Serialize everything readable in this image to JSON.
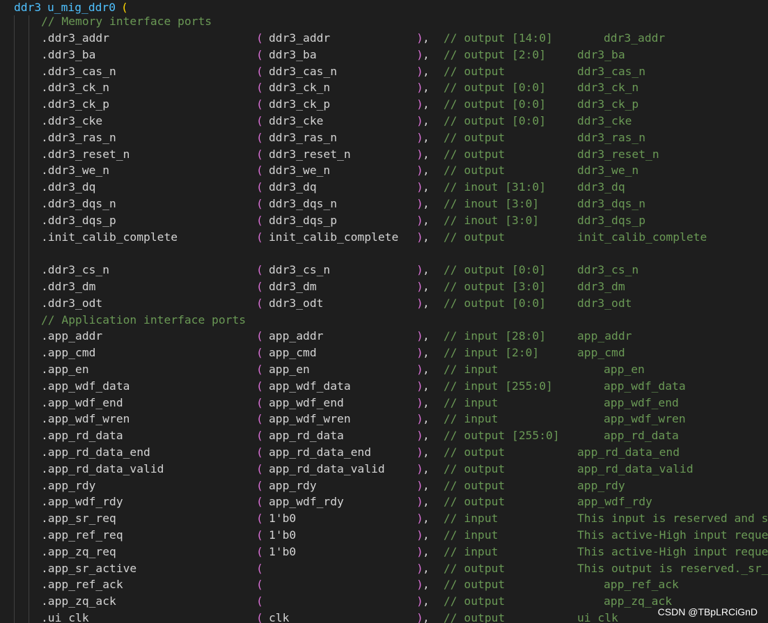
{
  "editor": {
    "instance_header": {
      "module": "ddr3",
      "instance": "u_mig_ddr0",
      "open_paren": "("
    },
    "section_memory": "// Memory interface ports",
    "section_app": "// Application interface ports",
    "ports": [
      {
        "port": ".ddr3_addr",
        "signal": "ddr3_addr",
        "dir": "// output [14:0]",
        "desc": "ddr3_addr",
        "desc_indent": true
      },
      {
        "port": ".ddr3_ba",
        "signal": "ddr3_ba",
        "dir": "// output [2:0]",
        "desc": "ddr3_ba",
        "desc_indent": false
      },
      {
        "port": ".ddr3_cas_n",
        "signal": "ddr3_cas_n",
        "dir": "// output",
        "desc": "ddr3_cas_n",
        "desc_indent": false
      },
      {
        "port": ".ddr3_ck_n",
        "signal": "ddr3_ck_n",
        "dir": "// output [0:0]",
        "desc": "ddr3_ck_n",
        "desc_indent": false
      },
      {
        "port": ".ddr3_ck_p",
        "signal": "ddr3_ck_p",
        "dir": "// output [0:0]",
        "desc": "ddr3_ck_p",
        "desc_indent": false
      },
      {
        "port": ".ddr3_cke",
        "signal": "ddr3_cke",
        "dir": "// output [0:0]",
        "desc": "ddr3_cke",
        "desc_indent": false
      },
      {
        "port": ".ddr3_ras_n",
        "signal": "ddr3_ras_n",
        "dir": "// output",
        "desc": "ddr3_ras_n",
        "desc_indent": false
      },
      {
        "port": ".ddr3_reset_n",
        "signal": "ddr3_reset_n",
        "dir": "// output",
        "desc": "ddr3_reset_n",
        "desc_indent": false
      },
      {
        "port": ".ddr3_we_n",
        "signal": "ddr3_we_n",
        "dir": "// output",
        "desc": "ddr3_we_n",
        "desc_indent": false
      },
      {
        "port": ".ddr3_dq",
        "signal": "ddr3_dq",
        "dir": "// inout [31:0]",
        "desc": "ddr3_dq",
        "desc_indent": false
      },
      {
        "port": ".ddr3_dqs_n",
        "signal": "ddr3_dqs_n",
        "dir": "// inout [3:0]",
        "desc": "ddr3_dqs_n",
        "desc_indent": false
      },
      {
        "port": ".ddr3_dqs_p",
        "signal": "ddr3_dqs_p",
        "dir": "// inout [3:0]",
        "desc": "ddr3_dqs_p",
        "desc_indent": false
      },
      {
        "port": ".init_calib_complete",
        "signal": "init_calib_complete",
        "dir": "// output",
        "desc": "init_calib_complete",
        "desc_indent": false
      },
      {
        "blank": true
      },
      {
        "port": ".ddr3_cs_n",
        "signal": "ddr3_cs_n",
        "dir": "// output [0:0]",
        "desc": "ddr3_cs_n",
        "desc_indent": false
      },
      {
        "port": ".ddr3_dm",
        "signal": "ddr3_dm",
        "dir": "// output [3:0]",
        "desc": "ddr3_dm",
        "desc_indent": false
      },
      {
        "port": ".ddr3_odt",
        "signal": "ddr3_odt",
        "dir": "// output [0:0]",
        "desc": "ddr3_odt",
        "desc_indent": false
      },
      {
        "section": "app"
      },
      {
        "port": ".app_addr",
        "signal": "app_addr",
        "dir": "// input [28:0]",
        "desc": "app_addr",
        "desc_indent": false
      },
      {
        "port": ".app_cmd",
        "signal": "app_cmd",
        "dir": "// input [2:0]",
        "desc": "app_cmd",
        "desc_indent": false
      },
      {
        "port": ".app_en",
        "signal": "app_en",
        "dir": "// input",
        "desc": "app_en",
        "desc_indent": true
      },
      {
        "port": ".app_wdf_data",
        "signal": "app_wdf_data",
        "dir": "// input [255:0]",
        "desc": "app_wdf_data",
        "desc_indent": true
      },
      {
        "port": ".app_wdf_end",
        "signal": "app_wdf_end",
        "dir": "// input",
        "desc": "app_wdf_end",
        "desc_indent": true
      },
      {
        "port": ".app_wdf_wren",
        "signal": "app_wdf_wren",
        "dir": "// input",
        "desc": "app_wdf_wren",
        "desc_indent": true
      },
      {
        "port": ".app_rd_data",
        "signal": "app_rd_data",
        "dir": "// output [255:0]",
        "desc": "app_rd_data",
        "desc_indent": true
      },
      {
        "port": ".app_rd_data_end",
        "signal": "app_rd_data_end",
        "dir": "// output",
        "desc": "app_rd_data_end",
        "desc_indent": false
      },
      {
        "port": ".app_rd_data_valid",
        "signal": "app_rd_data_valid",
        "dir": "// output",
        "desc": "app_rd_data_valid",
        "desc_indent": false
      },
      {
        "port": ".app_rdy",
        "signal": "app_rdy",
        "dir": "// output",
        "desc": "app_rdy",
        "desc_indent": false
      },
      {
        "port": ".app_wdf_rdy",
        "signal": "app_wdf_rdy",
        "dir": "// output",
        "desc": "app_wdf_rdy",
        "desc_indent": false
      },
      {
        "port": ".app_sr_req",
        "signal": "1'b0",
        "dir": "// input",
        "desc": "This input is reserved and sh",
        "desc_indent": false
      },
      {
        "port": ".app_ref_req",
        "signal": "1'b0",
        "dir": "// input",
        "desc": "This active-High input reques",
        "desc_indent": false
      },
      {
        "port": ".app_zq_req",
        "signal": "1'b0",
        "dir": "// input",
        "desc": "This active-High input reques",
        "desc_indent": false
      },
      {
        "port": ".app_sr_active",
        "signal": "",
        "dir": "// output",
        "desc": "This output is reserved._sr_a",
        "desc_indent": false
      },
      {
        "port": ".app_ref_ack",
        "signal": "",
        "dir": "// output",
        "desc": "app_ref_ack",
        "desc_indent": true
      },
      {
        "port": ".app_zq_ack",
        "signal": "",
        "dir": "// output",
        "desc": "app_zq_ack",
        "desc_indent": true
      },
      {
        "port": ".ui_clk",
        "signal": "clk",
        "dir": "// output",
        "desc": "ui_clk",
        "desc_indent": false
      }
    ],
    "paren_open": "(",
    "paren_close": ")",
    "comma": ","
  },
  "watermark": "CSDN @TBpLRCiGnD",
  "colors": {
    "background": "#1e1e1e",
    "instance": "#4fc1ff",
    "bracket_gold": "#ffd700",
    "bracket_purple": "#da70d6",
    "comment": "#6a9955",
    "text": "#d4d4d4"
  }
}
